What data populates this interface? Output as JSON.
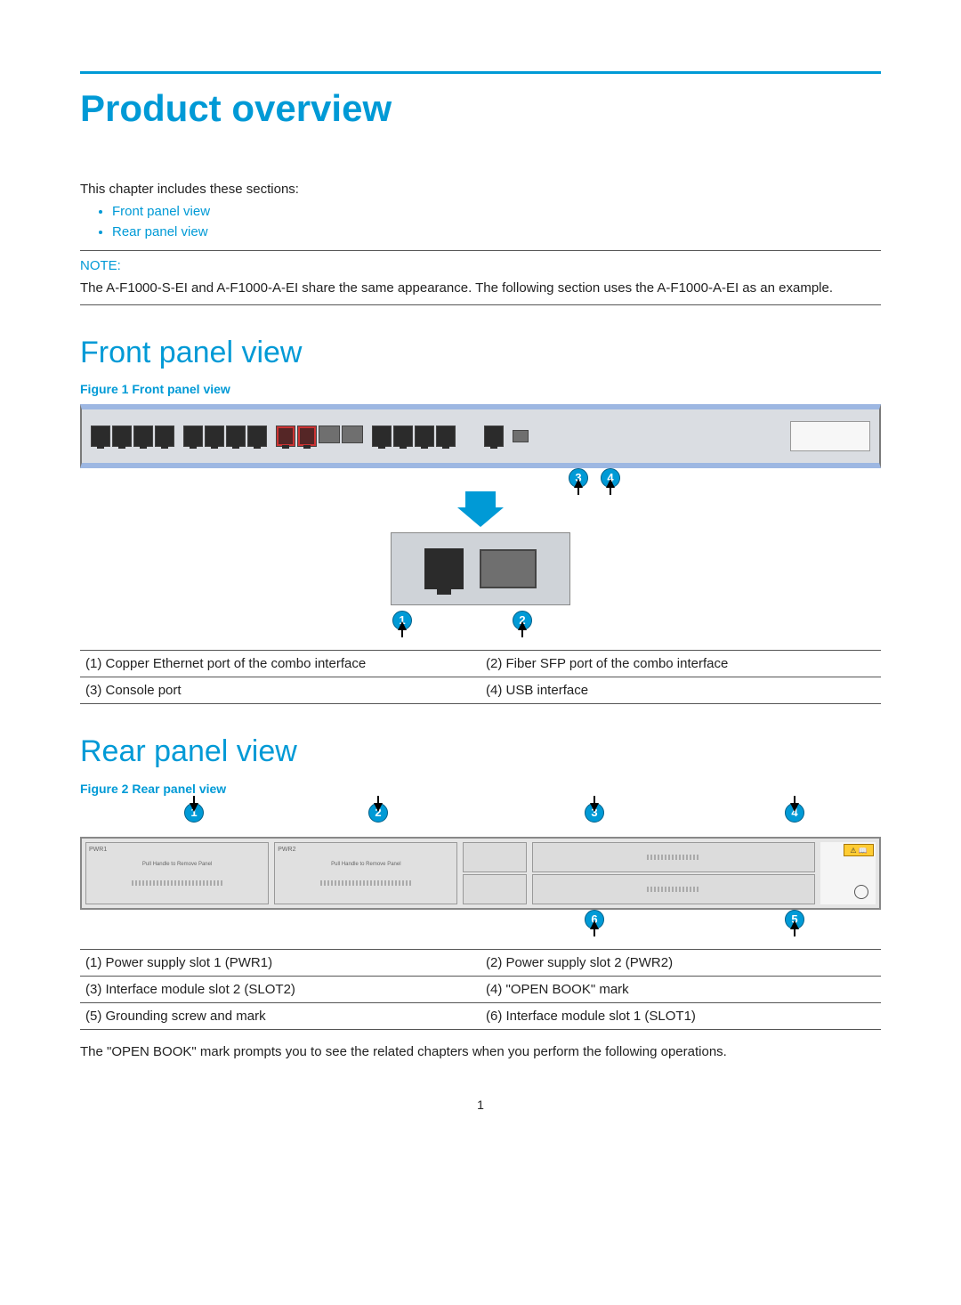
{
  "title": "Product overview",
  "intro": "This chapter includes these sections:",
  "toc": [
    "Front panel view",
    "Rear panel view"
  ],
  "note_label": "NOTE:",
  "note_text": "The A-F1000-S-EI and A-F1000-A-EI share the same appearance. The following section uses the A-F1000-A-EI as an example.",
  "section1": {
    "heading": "Front panel view",
    "caption": "Figure 1 Front panel view",
    "legend": [
      [
        "(1) Copper Ethernet port of the combo interface",
        "(2) Fiber SFP port of the combo interface"
      ],
      [
        "(3) Console port",
        "(4) USB interface"
      ]
    ]
  },
  "section2": {
    "heading": "Rear panel view",
    "caption": "Figure 2 Rear panel view",
    "legend": [
      [
        "(1) Power supply slot 1 (PWR1)",
        "(2) Power supply slot 2 (PWR2)"
      ],
      [
        "(3) Interface module slot 2 (SLOT2)",
        "(4) \"OPEN BOOK\" mark"
      ],
      [
        "(5) Grounding screw and mark",
        "(6) Interface module slot 1 (SLOT1)"
      ]
    ],
    "body": "The \"OPEN BOOK\" mark prompts you to see the related chapters when you perform the following operations."
  },
  "callouts": {
    "c1": "1",
    "c2": "2",
    "c3": "3",
    "c4": "4",
    "c5": "5",
    "c6": "6"
  },
  "page_number": "1"
}
